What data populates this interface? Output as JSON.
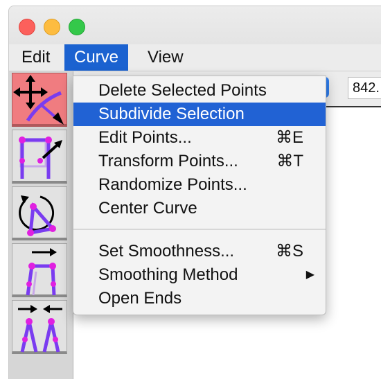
{
  "menubar": {
    "items": [
      {
        "label": "Edit"
      },
      {
        "label": "Curve",
        "active": true
      },
      {
        "label": "View"
      }
    ]
  },
  "toolbar": {
    "tools": [
      {
        "icon": "move-curve-tool-icon",
        "selected": true
      },
      {
        "icon": "scale-points-tool-icon",
        "selected": false
      },
      {
        "icon": "rotate-points-tool-icon",
        "selected": false
      },
      {
        "icon": "spread-points-tool-icon",
        "selected": false
      },
      {
        "icon": "compress-points-tool-icon",
        "selected": false
      }
    ]
  },
  "topstrip": {
    "number_value": "842."
  },
  "curve_menu": {
    "items": [
      {
        "label": "Delete Selected Points",
        "shortcut": ""
      },
      {
        "label": "Subdivide Selection",
        "shortcut": "",
        "highlighted": true
      },
      {
        "label": "Edit Points...",
        "shortcut": "⌘E"
      },
      {
        "label": "Transform Points...",
        "shortcut": "⌘T"
      },
      {
        "label": "Randomize Points...",
        "shortcut": ""
      },
      {
        "label": "Center Curve",
        "shortcut": ""
      },
      {
        "label": "Set Smoothness...",
        "shortcut": "⌘S"
      },
      {
        "label": "Smoothing Method",
        "shortcut": "",
        "submenu_arrow": "▶"
      },
      {
        "label": "Open Ends",
        "shortcut": ""
      }
    ]
  },
  "colors": {
    "menu_highlight": "#2162d4",
    "tool_selected": "#f07c80",
    "point_magenta": "#e020e0",
    "curve_purple": "#7a3cf0"
  }
}
